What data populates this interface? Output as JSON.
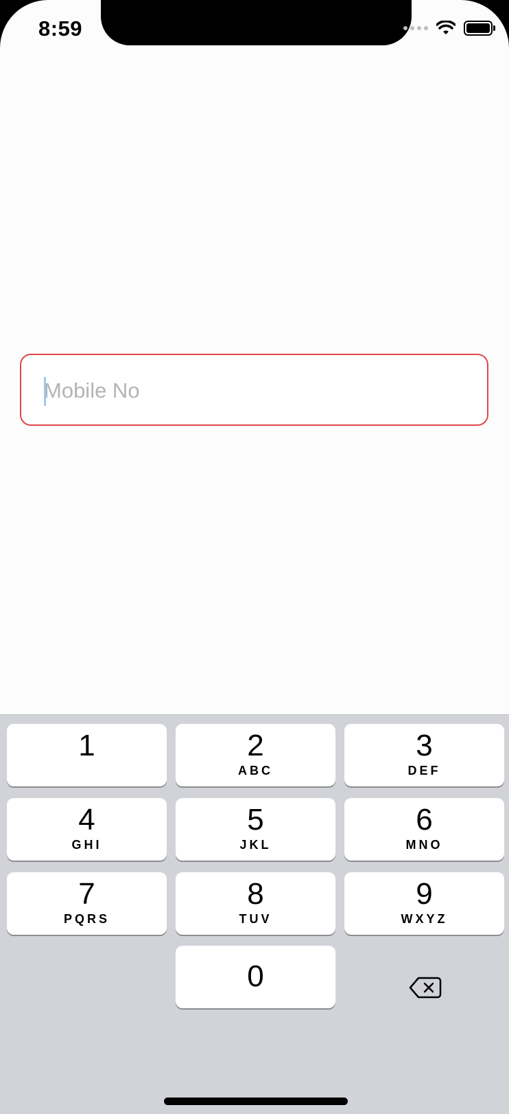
{
  "status_bar": {
    "time": "8:59"
  },
  "input": {
    "placeholder": "Mobile No"
  },
  "keyboard": {
    "keys": [
      {
        "num": "1",
        "letters": ""
      },
      {
        "num": "2",
        "letters": "ABC"
      },
      {
        "num": "3",
        "letters": "DEF"
      },
      {
        "num": "4",
        "letters": "GHI"
      },
      {
        "num": "5",
        "letters": "JKL"
      },
      {
        "num": "6",
        "letters": "MNO"
      },
      {
        "num": "7",
        "letters": "PQRS"
      },
      {
        "num": "8",
        "letters": "TUV"
      },
      {
        "num": "9",
        "letters": "WXYZ"
      },
      {
        "num": "0",
        "letters": ""
      }
    ],
    "delete_icon": "backspace-icon"
  },
  "colors": {
    "input_border": "#e0474a",
    "keyboard_bg": "#d1d3d9"
  }
}
